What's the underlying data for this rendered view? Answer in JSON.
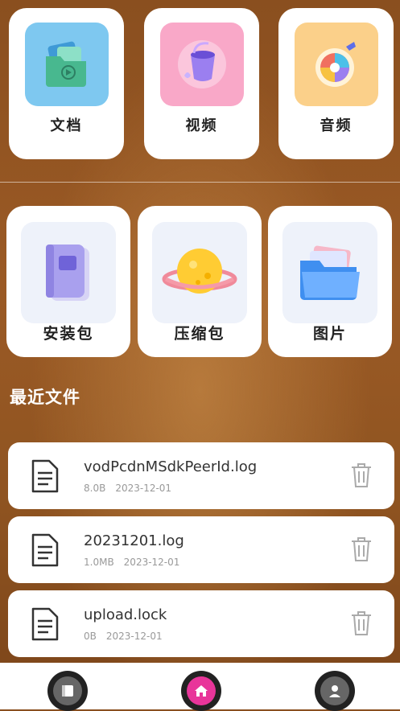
{
  "categories_top": [
    {
      "label": "文档",
      "icon": "document-folder-icon",
      "color": "#7ec8f0"
    },
    {
      "label": "视频",
      "icon": "video-bucket-icon",
      "color": "#f9a8c8"
    },
    {
      "label": "音频",
      "icon": "music-disc-icon",
      "color": "#fbd08a"
    }
  ],
  "categories_bottom": [
    {
      "label": "安装包",
      "icon": "install-package-icon"
    },
    {
      "label": "压缩包",
      "icon": "zip-planet-icon"
    },
    {
      "label": "图片",
      "icon": "image-folder-icon"
    }
  ],
  "recent": {
    "title": "最近文件",
    "files": [
      {
        "name": "vodPcdnMSdkPeerId.log",
        "size": "8.0B",
        "date": "2023-12-01"
      },
      {
        "name": "20231201.log",
        "size": "1.0MB",
        "date": "2023-12-01"
      },
      {
        "name": "upload.lock",
        "size": "0B",
        "date": "2023-12-01"
      }
    ]
  },
  "nav": [
    {
      "icon": "files-icon",
      "active": false
    },
    {
      "icon": "home-icon",
      "active": true
    },
    {
      "icon": "profile-icon",
      "active": false
    }
  ],
  "colors": {
    "accent": "#e8359a",
    "card": "#ffffff"
  }
}
